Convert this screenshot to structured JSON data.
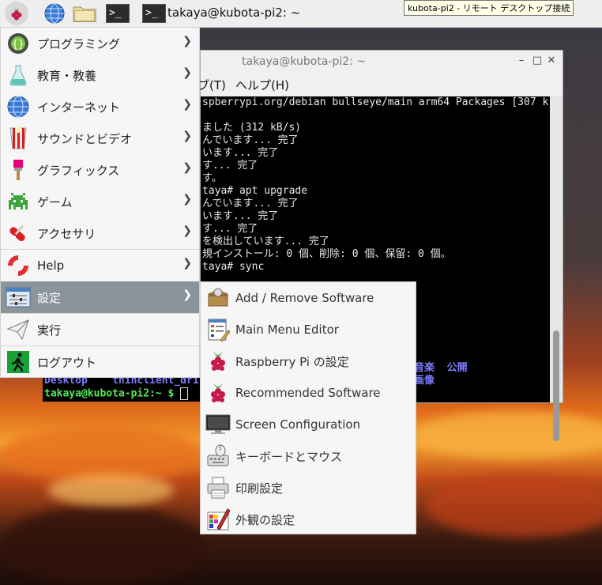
{
  "panel": {
    "title": "takaya@kubota-pi2: ~",
    "tooltip": "kubota-pi2 - リモート デスクトップ接続"
  },
  "terminal": {
    "title": "takaya@kubota-pi2: ~",
    "menu_left_fragment": "ブ(T)",
    "menu_help": "ヘルプ(H)",
    "lines": [
      "spberrypi.org/debian bullseye/main arm64 Packages [307 k",
      "ました (312 kB/s)",
      "んでいます... 完了",
      "います... 完了",
      "す... 完了",
      "す。",
      "taya# apt upgrade",
      "んでいます... 完了",
      "います... 完了",
      "す... 完了",
      "を検出しています... 完了",
      "規インストール: 0 個、削除: 0 個、保留: 0 個。",
      "taya# sync"
    ],
    "ls_right_1": "音楽  公開",
    "ls_right_2": "画像",
    "ls_left": "Desktop    thinclient_dri",
    "prompt": "takaya@kubota-pi2:~ $"
  },
  "main_menu": {
    "items": [
      {
        "label": "プログラミング",
        "icon": "programming-icon"
      },
      {
        "label": "教育・教養",
        "icon": "education-icon"
      },
      {
        "label": "インターネット",
        "icon": "internet-icon"
      },
      {
        "label": "サウンドとビデオ",
        "icon": "sound-video-icon"
      },
      {
        "label": "グラフィックス",
        "icon": "graphics-icon"
      },
      {
        "label": "ゲーム",
        "icon": "game-icon"
      },
      {
        "label": "アクセサリ",
        "icon": "accessories-icon"
      },
      {
        "label": "Help",
        "icon": "help-icon"
      },
      {
        "label": "設定",
        "icon": "settings-icon"
      },
      {
        "label": "実行",
        "icon": "run-icon"
      },
      {
        "label": "ログアウト",
        "icon": "logout-icon"
      }
    ]
  },
  "sub_menu": {
    "items": [
      {
        "label": "Add / Remove Software",
        "icon": "package-icon"
      },
      {
        "label": "Main Menu Editor",
        "icon": "menu-editor-icon"
      },
      {
        "label": "Raspberry Pi の設定",
        "icon": "raspberry-icon"
      },
      {
        "label": "Recommended Software",
        "icon": "raspberry-icon"
      },
      {
        "label": "Screen Configuration",
        "icon": "monitor-icon"
      },
      {
        "label": "キーボードとマウス",
        "icon": "keyboard-mouse-icon"
      },
      {
        "label": "印刷設定",
        "icon": "printer-icon"
      },
      {
        "label": "外観の設定",
        "icon": "appearance-icon"
      }
    ]
  },
  "colors": {
    "panel_bg": "#eeeeee",
    "menu_bg": "#f6f6f6",
    "menu_active": "#8b939b",
    "terminal_bg": "#000000",
    "prompt_green": "#56e856",
    "dir_blue": "#7b7bff"
  }
}
